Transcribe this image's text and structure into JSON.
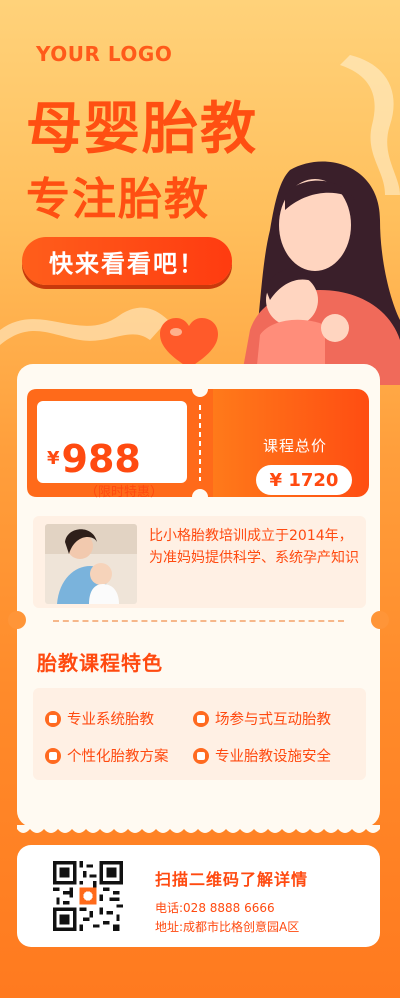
{
  "header": {
    "logo": "YOUR LOGO",
    "title_main": "母婴胎教",
    "title_sub": "专注胎教",
    "cta_label": "快来看看吧！"
  },
  "ticket": {
    "currency": "¥",
    "price": "988",
    "price_note": "（限时特惠）",
    "total_label": "课程总价",
    "total_price": "¥ 1720"
  },
  "intro": {
    "text": "比小格胎教培训成立于2014年，为准妈妈提供科学、系统孕产知识"
  },
  "features": {
    "title": "胎教课程特色",
    "items": [
      {
        "label": "专业系统胎教",
        "icon": "heart-icon"
      },
      {
        "label": "场参与式互动胎教",
        "icon": "person-icon"
      },
      {
        "label": "个性化胎教方案",
        "icon": "document-icon"
      },
      {
        "label": "专业胎教设施安全",
        "icon": "shield-icon"
      }
    ]
  },
  "contact": {
    "scan_title": "扫描二维码了解详情",
    "phone": "电话:028 8888 6666",
    "address": "地址:成都市比格创意园A区"
  },
  "colors": {
    "accent": "#ff4a10",
    "card_bg": "#fffaf2",
    "tint_bg": "#fff0e4"
  }
}
